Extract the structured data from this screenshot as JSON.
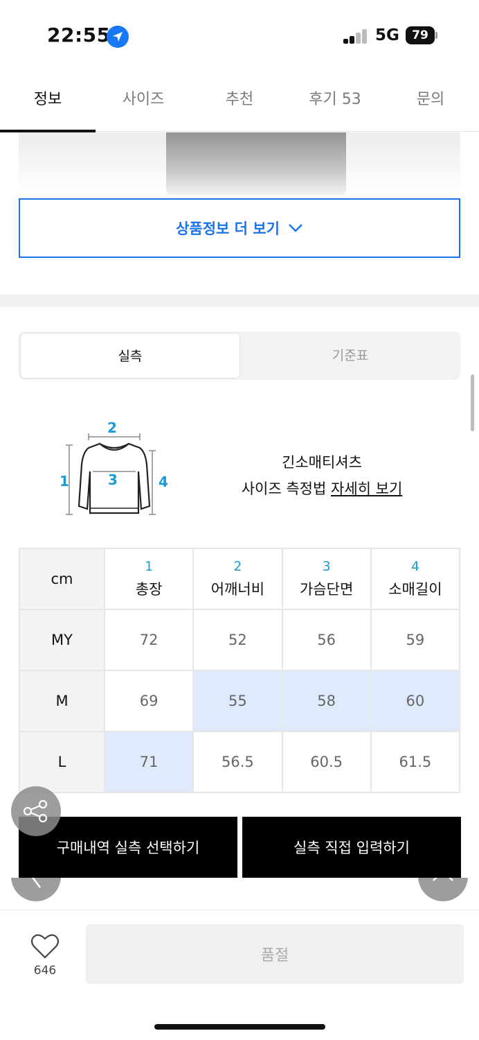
{
  "status_bar": {
    "time": "22:55",
    "network": "5G",
    "battery": "79"
  },
  "tabs": [
    {
      "label": "정보",
      "active": true
    },
    {
      "label": "사이즈",
      "active": false
    },
    {
      "label": "추천",
      "active": false
    },
    {
      "label": "후기 53",
      "active": false
    },
    {
      "label": "문의",
      "active": false
    }
  ],
  "more_info_button": "상품정보 더 보기",
  "segment": {
    "actual": "실측",
    "standard": "기준표"
  },
  "size_guide": {
    "diagram_numbers": [
      "1",
      "2",
      "3",
      "4"
    ],
    "category": "긴소매티셔츠",
    "how_to_prefix": "사이즈 측정법 ",
    "how_to_link": "자세히 보기"
  },
  "size_table": {
    "unit": "cm",
    "columns": [
      {
        "num": "1",
        "label": "총장"
      },
      {
        "num": "2",
        "label": "어깨너비"
      },
      {
        "num": "3",
        "label": "가슴단면"
      },
      {
        "num": "4",
        "label": "소매길이"
      }
    ],
    "rows": [
      {
        "size": "MY",
        "values": [
          "72",
          "52",
          "56",
          "59"
        ]
      },
      {
        "size": "M",
        "values": [
          "69",
          "55",
          "58",
          "60"
        ]
      },
      {
        "size": "L",
        "values": [
          "71",
          "56.5",
          "60.5",
          "61.5"
        ]
      }
    ]
  },
  "actions": {
    "select_purchase": "구매내역 실측 선택하기",
    "direct_input": "실측 직접 입력하기"
  },
  "bottom": {
    "likes": "646",
    "soldout": "품절"
  },
  "colors": {
    "accent_blue": "#1a73e8",
    "highlight": "#dfeafc",
    "number_cyan": "#1a9bd6"
  }
}
